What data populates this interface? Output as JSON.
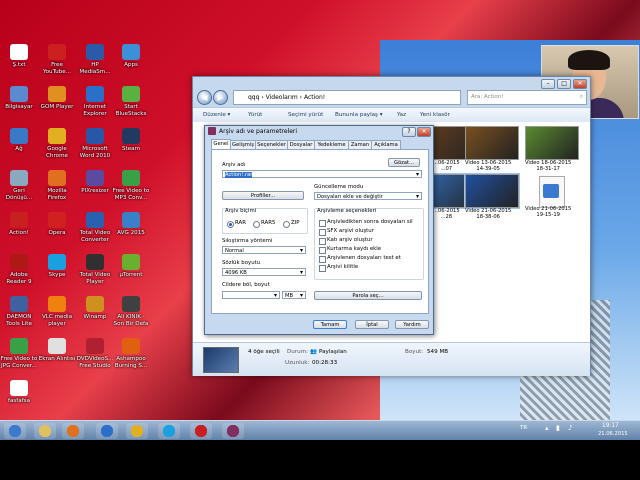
{
  "desktop_icons": [
    {
      "label": "Ş.txt",
      "icon": "text-file-icon",
      "color": "#ffffff"
    },
    {
      "label": "Free YouTube...",
      "icon": "youtube-downloader-icon",
      "color": "#cc2020"
    },
    {
      "label": "HP MediaSm...",
      "icon": "hp-mediasmart-icon",
      "color": "#2a5aa8"
    },
    {
      "label": "Apps",
      "icon": "apps-icon",
      "color": "#3d8fd8"
    },
    {
      "label": "Bilgisayar",
      "icon": "computer-icon",
      "color": "#5b8ad0"
    },
    {
      "label": "GOM Player",
      "icon": "gom-player-icon",
      "color": "#e09020"
    },
    {
      "label": "Internet Explorer",
      "icon": "internet-explorer-icon",
      "color": "#2a70c8"
    },
    {
      "label": "Start BlueStacks",
      "icon": "bluestacks-icon",
      "color": "#5ab040"
    },
    {
      "label": "Ağ",
      "icon": "network-icon",
      "color": "#3a78c8"
    },
    {
      "label": "Google Chrome",
      "icon": "chrome-icon",
      "color": "#e0b020"
    },
    {
      "label": "Microsoft Word 2010",
      "icon": "word-icon",
      "color": "#2a56a8"
    },
    {
      "label": "Steam",
      "icon": "steam-icon",
      "color": "#233a60"
    },
    {
      "label": "Geri Dönüşü...",
      "icon": "recycle-bin-icon",
      "color": "#8aa8c0"
    },
    {
      "label": "Mozilla Firefox",
      "icon": "firefox-icon",
      "color": "#e07020"
    },
    {
      "label": "PIXresizer",
      "icon": "pixresizer-icon",
      "color": "#5a4aa0"
    },
    {
      "label": "Free Video to MP3 Conv...",
      "icon": "video-to-mp3-icon",
      "color": "#3aa048"
    },
    {
      "label": "Action!",
      "icon": "action-icon",
      "color": "#c82020"
    },
    {
      "label": "Opera",
      "icon": "opera-icon",
      "color": "#d02020"
    },
    {
      "label": "Total Video Converter",
      "icon": "total-video-converter-icon",
      "color": "#2a60b0"
    },
    {
      "label": "AVG 2015",
      "icon": "avg-icon",
      "color": "#3a80c8"
    },
    {
      "label": "Adobe Reader 9",
      "icon": "adobe-reader-icon",
      "color": "#b01818"
    },
    {
      "label": "Skype",
      "icon": "skype-icon",
      "color": "#1aa0e0"
    },
    {
      "label": "Total Video Player",
      "icon": "total-video-player-icon",
      "color": "#303030"
    },
    {
      "label": "µTorrent",
      "icon": "utorrent-icon",
      "color": "#6ab030"
    },
    {
      "label": "DAEMON Tools Lite",
      "icon": "daemon-tools-icon",
      "color": "#4060a0"
    },
    {
      "label": "VLC media player",
      "icon": "vlc-icon",
      "color": "#f08010"
    },
    {
      "label": "Winamp",
      "icon": "winamp-icon",
      "color": "#d09020"
    },
    {
      "label": "Ali KINIK - Son Bir Defa",
      "icon": "audio-file-icon",
      "color": "#404040"
    },
    {
      "label": "Free Video to JPG Conver...",
      "icon": "video-to-jpg-icon",
      "color": "#3aa048"
    },
    {
      "label": "Ekran Alıntısı",
      "icon": "snipping-tool-icon",
      "color": "#e0e0e0"
    },
    {
      "label": "DVDVideoS... Free Studio",
      "icon": "dvdvideosoft-icon",
      "color": "#b02030"
    },
    {
      "label": "Ashampoo Burning S...",
      "icon": "ashampoo-icon",
      "color": "#e06010"
    },
    {
      "label": "fasfafsa",
      "icon": "text-file-icon",
      "color": "#ffffff"
    }
  ],
  "explorer": {
    "address": "qqq › Videolarım › Action!",
    "search_placeholder": "Ara: Action!",
    "toolbar": [
      "Düzenle ▾",
      "Yürüt",
      "Seçimi yürüt",
      "Bununla paylaş ▾",
      "Yaz",
      "Yeni klasör"
    ],
    "thumbnails": [
      {
        "label": "...06-2015\n...07",
        "color": "#5a3a20"
      },
      {
        "label": "Video 13-06-2015\n14-39-05",
        "color": "#7a5020"
      },
      {
        "label": "Video 18-06-2015\n18-31-17",
        "color": "#5a8a30"
      },
      {
        "label": "...06-2015\n...28",
        "color": "#3060a0"
      },
      {
        "label": "Video 21-06-2015\n18-38-06",
        "color": "#2050a0"
      },
      {
        "label": "Video 21-06-2015\n19-15-19",
        "color": "#ffffff"
      }
    ],
    "details": {
      "count_label": "4 öğe seçili",
      "state_key": "Durum:",
      "state_value": "Paylaşılan",
      "length_key": "Uzunluk:",
      "length_value": "00:28:33",
      "size_key": "Boyut:",
      "size_value": "549 MB"
    }
  },
  "dialog": {
    "title": "Arşiv adı ve parametreleri",
    "tabs": [
      "Genel",
      "Gelişmiş",
      "Seçenekler",
      "Dosyalar",
      "Yedekleme",
      "Zaman",
      "Açıklama"
    ],
    "archive_name_label": "Arşiv adı",
    "archive_name_value": "Action!.rar",
    "browse_button": "Gözat...",
    "profiles_button": "Profiller...",
    "update_mode_label": "Güncelleme modu",
    "update_mode_value": "Dosyaları ekle ve değiştir",
    "format_group_label": "Arşiv biçimi",
    "formats": [
      "RAR",
      "RAR5",
      "ZIP"
    ],
    "selected_format": "RAR",
    "compression_label": "Sıkıştırma yöntemi",
    "compression_value": "Normal",
    "dictionary_label": "Sözlük boyutu",
    "dictionary_value": "4096 KB",
    "split_label": "Cildere böl, boyut",
    "split_unit": "MB",
    "archiving_options_label": "Arşivleme seçenekleri",
    "options": [
      "Arşivledikten sonra dosyaları sil",
      "SFX arşivi oluştur",
      "Katı arşiv oluştur",
      "Kurtarma kaydı ekle",
      "Arşivlenen dosyaları test et",
      "Arşivi kilitle"
    ],
    "password_button": "Parola seç...",
    "ok_button": "Tamam",
    "cancel_button": "İptal",
    "help_button": "Yardım"
  },
  "taskbar": {
    "lang": "TR",
    "time": "19:17",
    "date": "21.06.2015",
    "items": [
      {
        "icon": "windows-start-icon",
        "color": "#3a7ad0"
      },
      {
        "icon": "folder-icon",
        "color": "#e0c060"
      },
      {
        "icon": "media-player-icon",
        "color": "#e07020"
      },
      {
        "icon": "internet-explorer-icon",
        "color": "#2a70c8"
      },
      {
        "icon": "chrome-icon",
        "color": "#e0b020"
      },
      {
        "icon": "skype-icon",
        "color": "#1aa0e0"
      },
      {
        "icon": "action-recorder-icon",
        "color": "#c82020"
      },
      {
        "icon": "winrar-icon",
        "color": "#803060"
      }
    ]
  }
}
